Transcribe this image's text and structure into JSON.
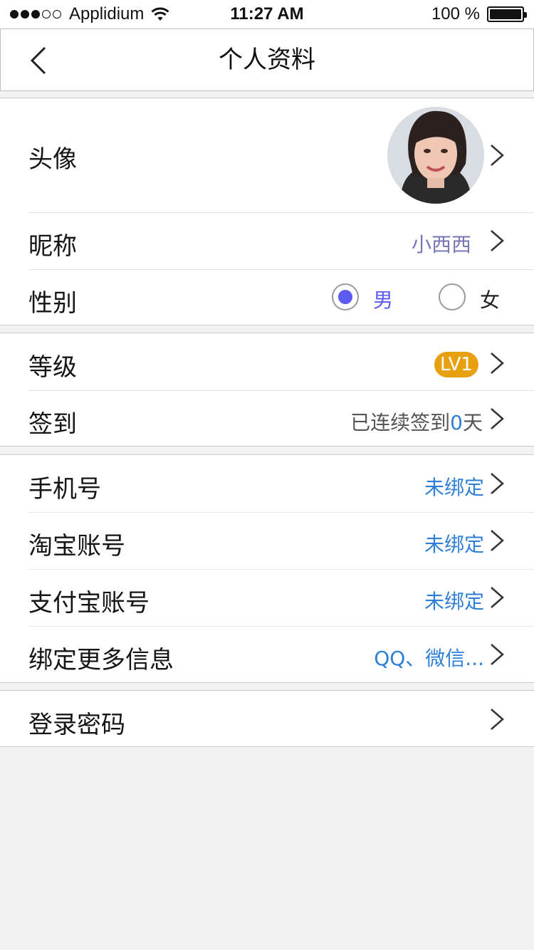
{
  "status_bar": {
    "carrier": "Applidium",
    "time": "11:27 AM",
    "battery": "100 %",
    "signal_bars_filled": 3,
    "signal_bars_total": 5
  },
  "header": {
    "title": "个人资料",
    "back_icon": "chevron-left-icon"
  },
  "profile": {
    "avatar_label": "头像",
    "nickname_label": "昵称",
    "nickname_value": "小西西",
    "gender_label": "性别",
    "gender_options": [
      "男",
      "女"
    ],
    "gender_selected": "男"
  },
  "level_section": {
    "level_label": "等级",
    "level_value": "LV1",
    "checkin_label": "签到",
    "checkin_prefix": "已连续签到",
    "checkin_days": "0",
    "checkin_suffix": "天"
  },
  "bindings": {
    "phone_label": "手机号",
    "phone_value": "未绑定",
    "taobao_label": "淘宝账号",
    "taobao_value": "未绑定",
    "alipay_label": "支付宝账号",
    "alipay_value": "未绑定",
    "more_label": "绑定更多信息",
    "more_value": "QQ、微信..."
  },
  "security": {
    "password_label": "登录密码"
  },
  "colors": {
    "accent_blue": "#2f7fd8",
    "nickname_purple": "#7777b8",
    "radio_selected": "#5b5bf0",
    "level_badge": "#e7a010"
  }
}
